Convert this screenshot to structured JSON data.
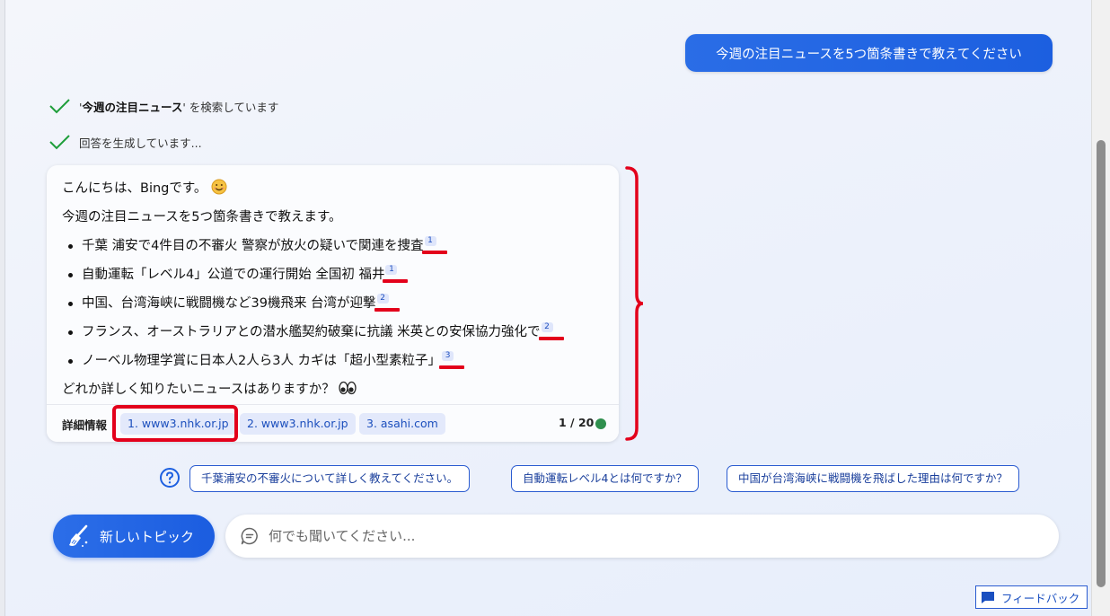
{
  "user_message": "今週の注目ニュースを5つ箇条書きで教えてください",
  "status": {
    "search_query": "今週の注目ニュース",
    "search_suffix": "を検索しています",
    "generating": "回答を生成しています..."
  },
  "answer": {
    "greeting": "こんにちは、Bingです。",
    "intro": "今週の注目ニュースを5つ箇条書きで教えます。",
    "items": [
      {
        "text": "千葉 浦安で4件目の不審火 警察が放火の疑いで関連を捜査",
        "cite": "1"
      },
      {
        "text": "自動運転「レベル4」公道での運行開始 全国初 福井",
        "cite": "1"
      },
      {
        "text": "中国、台湾海峡に戦闘機など39機飛来 台湾が迎撃",
        "cite": "2"
      },
      {
        "text": "フランス、オーストラリアとの潜水艦契約破棄に抗議 米英との安保協力強化で",
        "cite": "2"
      },
      {
        "text": "ノーベル物理学賞に日本人2人ら3人 カギは「超小型素粒子」",
        "cite": "3"
      }
    ],
    "closing": "どれか詳しく知りたいニュースはありますか？",
    "footer_label": "詳細情報",
    "sources": [
      "1. www3.nhk.or.jp",
      "2. www3.nhk.or.jp",
      "3. asahi.com"
    ],
    "page_counter": "1 / 20"
  },
  "suggestions": [
    "千葉浦安の不審火について詳しく教えてください。",
    "自動運転レベル4とは何ですか？",
    "中国が台湾海峡に戦闘機を飛ばした理由は何ですか？"
  ],
  "new_topic_label": "新しいトピック",
  "chat_input": {
    "placeholder": "何でも聞いてください...",
    "value": ""
  },
  "feedback_label": "フィードバック",
  "colors": {
    "accent": "#1c5fe0",
    "annotation_red": "#e3001b",
    "status_green": "#2f8f4e",
    "check_green": "#1e9e3a"
  },
  "icons": [
    "check-icon",
    "smile-emoji-icon",
    "eyes-emoji-icon",
    "help-circle-icon",
    "broom-icon",
    "chat-bubble-icon",
    "feedback-icon"
  ]
}
